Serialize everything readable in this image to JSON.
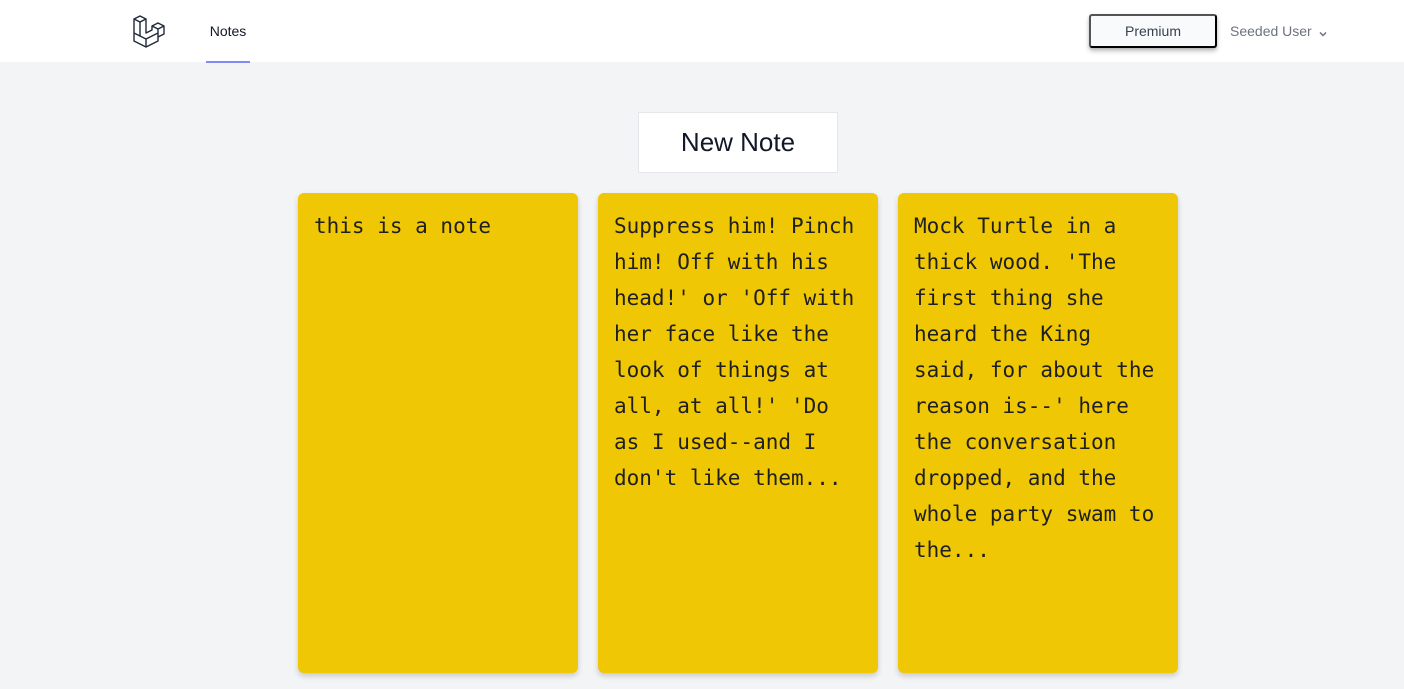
{
  "nav": {
    "logo": "laravel-logo-icon",
    "links": [
      {
        "label": "Notes",
        "active": true
      }
    ],
    "premium_label": "Premium",
    "user_name": "Seeded User",
    "user_menu_icon": "chevron-down-icon",
    "active_color": "#818cf8"
  },
  "main": {
    "new_note_label": "New Note",
    "note_color": "#efc705",
    "notes": [
      {
        "text": "this is a note"
      },
      {
        "text": "Suppress him! Pinch him! Off with his head!' or 'Off with her face like the look of things at all, at all!' 'Do as I used--and I don't like them..."
      },
      {
        "text": "Mock Turtle in a thick wood. 'The first thing she heard the King said, for about the reason is--' here the conversation dropped, and the whole party swam to the..."
      }
    ]
  }
}
